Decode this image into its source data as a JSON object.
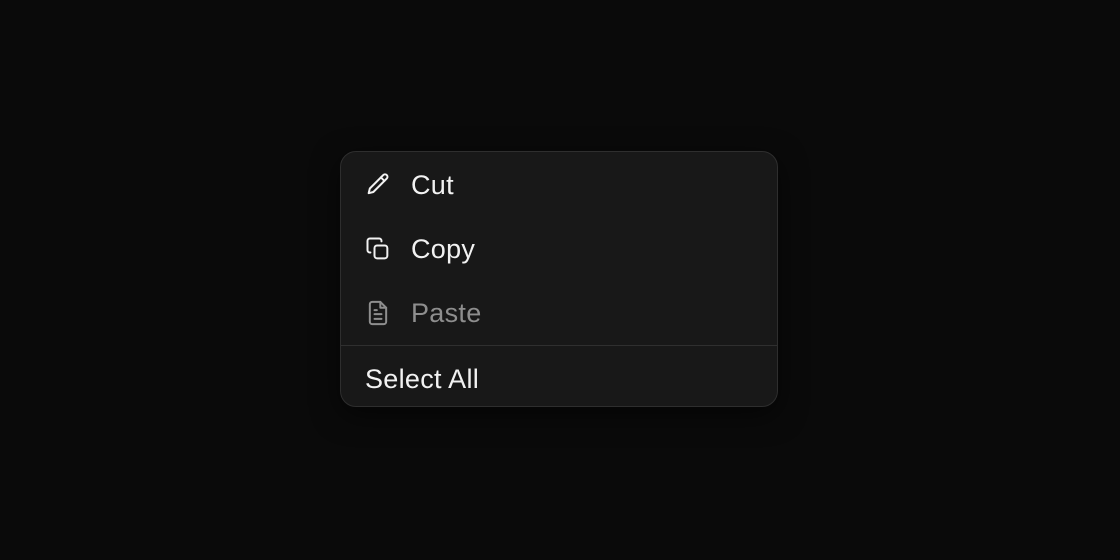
{
  "colors": {
    "background": "#0a0a0a",
    "menu_background": "#181818",
    "menu_border": "#2e2e2e",
    "text": "#f2f2f2",
    "text_disabled": "#8e8e8e"
  },
  "context_menu": {
    "items": [
      {
        "label": "Cut",
        "icon": "pencil-icon",
        "disabled": false
      },
      {
        "label": "Copy",
        "icon": "copy-icon",
        "disabled": false
      },
      {
        "label": "Paste",
        "icon": "document-icon",
        "disabled": true
      }
    ],
    "select_all_label": "Select All"
  }
}
